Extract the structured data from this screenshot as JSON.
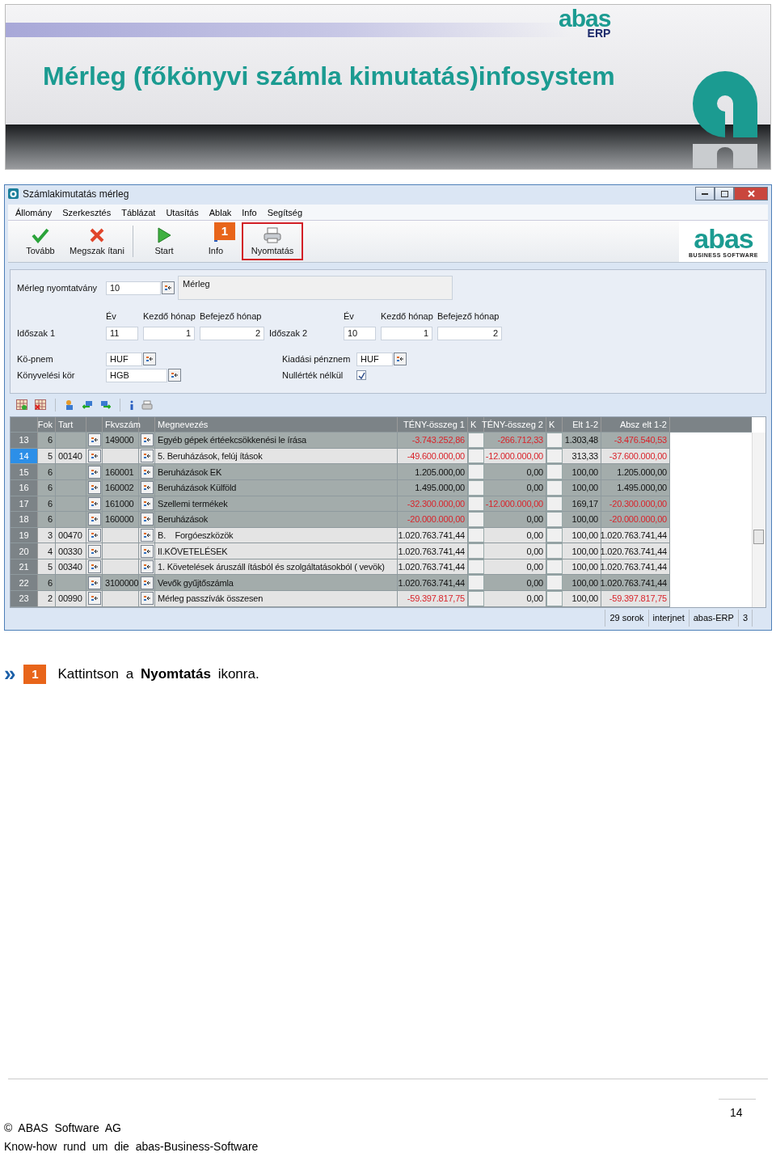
{
  "banner": {
    "title": "Mérleg (főkönyvi számla kimutatás)infosystem",
    "logo_word": "abas",
    "logo_sub": "ERP"
  },
  "window": {
    "title": "Számlakimutatás mérleg",
    "menu": [
      "Állomány",
      "Szerkesztés",
      "Táblázat",
      "Utasítás",
      "Ablak",
      "Info",
      "Segítség"
    ],
    "toolbar": [
      {
        "kind": "check",
        "label": "Tovább",
        "highlighted": false
      },
      {
        "kind": "cancel",
        "label": "Megszak ítani",
        "highlighted": false
      },
      {
        "kind": "start",
        "label": "Start",
        "highlighted": false
      },
      {
        "kind": "info",
        "label": "Info",
        "highlighted": false
      },
      {
        "kind": "print",
        "label": "Nyomtatás",
        "highlighted": true,
        "callout": "1"
      }
    ],
    "brand": {
      "word": "abas",
      "sub": "BUSINESS SOFTWARE"
    },
    "form": {
      "print_form": {
        "label": "Mérleg nyomtatvány",
        "value": "10",
        "description": "Mérleg"
      },
      "periods": [
        {
          "headers": [
            "Év",
            "Kezdő hónap",
            "Befejező hónap"
          ],
          "label": "Időszak 1",
          "year": "11",
          "start": "1",
          "end": "2"
        },
        {
          "headers": [
            "Év",
            "Kezdő hónap",
            "Befejező hónap"
          ],
          "label": "Időszak 2",
          "year": "10",
          "start": "1",
          "end": "2"
        }
      ],
      "currency": {
        "label": "Kö-pnem",
        "value": "HUF"
      },
      "ledger": {
        "label": "Könyvelési kör",
        "value": "HGB"
      },
      "output_currency": {
        "label": "Kiadási pénznem",
        "value": "HUF"
      },
      "no_zero": {
        "label": "Nullérték nélkül",
        "checked": true
      }
    },
    "table": {
      "columns": [
        "Fok",
        "Tart",
        "Fkvszám",
        "Megnevezés",
        "TÉNY-összeg 1",
        "K",
        "TÉNY-összeg 2",
        "K",
        "Elt 1-2",
        "Absz elt 1-2"
      ],
      "rows": [
        {
          "num": "13",
          "kind": "account",
          "selected": false,
          "fok": "6",
          "tart": "",
          "account": "149000",
          "name": "Egyéb gépek értéekcsökkenési le írása",
          "t1": {
            "text": "-3.743.252,86",
            "negative": true
          },
          "t2": {
            "text": "-266.712,33",
            "negative": true
          },
          "elt": "1.303,48",
          "abs": {
            "text": "-3.476.540,53",
            "negative": true
          }
        },
        {
          "num": "14",
          "kind": "group",
          "selected": true,
          "fok": "5",
          "tart": "00140",
          "account": "",
          "name": "5. Beruházások, felúj ítások",
          "t1": {
            "text": "-49.600.000,00",
            "negative": true
          },
          "t2": {
            "text": "-12.000.000,00",
            "negative": true
          },
          "elt": "313,33",
          "abs": {
            "text": "-37.600.000,00",
            "negative": true
          }
        },
        {
          "num": "15",
          "kind": "account",
          "selected": false,
          "fok": "6",
          "tart": "",
          "account": "160001",
          "name": "Beruházások EK",
          "t1": {
            "text": "1.205.000,00",
            "negative": false
          },
          "t2": {
            "text": "0,00",
            "negative": false
          },
          "elt": "100,00",
          "abs": {
            "text": "1.205.000,00",
            "negative": false
          }
        },
        {
          "num": "16",
          "kind": "account",
          "selected": false,
          "fok": "6",
          "tart": "",
          "account": "160002",
          "name": "Beruházások Külföld",
          "t1": {
            "text": "1.495.000,00",
            "negative": false
          },
          "t2": {
            "text": "0,00",
            "negative": false
          },
          "elt": "100,00",
          "abs": {
            "text": "1.495.000,00",
            "negative": false
          }
        },
        {
          "num": "17",
          "kind": "account",
          "selected": false,
          "fok": "6",
          "tart": "",
          "account": "161000",
          "name": "Szellemi termékek",
          "t1": {
            "text": "-32.300.000,00",
            "negative": true
          },
          "t2": {
            "text": "-12.000.000,00",
            "negative": true
          },
          "elt": "169,17",
          "abs": {
            "text": "-20.300.000,00",
            "negative": true
          }
        },
        {
          "num": "18",
          "kind": "account",
          "selected": false,
          "fok": "6",
          "tart": "",
          "account": "160000",
          "name": "Beruházások",
          "t1": {
            "text": "-20.000.000,00",
            "negative": true
          },
          "t2": {
            "text": "0,00",
            "negative": false
          },
          "elt": "100,00",
          "abs": {
            "text": "-20.000.000,00",
            "negative": true
          }
        },
        {
          "num": "19",
          "kind": "group",
          "selected": false,
          "fok": "3",
          "tart": "00470",
          "account": "",
          "name": "B.    Forgóeszközök",
          "t1": {
            "text": "1.020.763.741,44",
            "negative": false
          },
          "t2": {
            "text": "0,00",
            "negative": false
          },
          "elt": "100,00",
          "abs": {
            "text": "1.020.763.741,44",
            "negative": false
          }
        },
        {
          "num": "20",
          "kind": "group",
          "selected": false,
          "fok": "4",
          "tart": "00330",
          "account": "",
          "name": "II.KÖVETELÉSEK",
          "t1": {
            "text": "1.020.763.741,44",
            "negative": false
          },
          "t2": {
            "text": "0,00",
            "negative": false
          },
          "elt": "100,00",
          "abs": {
            "text": "1.020.763.741,44",
            "negative": false
          }
        },
        {
          "num": "21",
          "kind": "group",
          "selected": false,
          "fok": "5",
          "tart": "00340",
          "account": "",
          "name": "1. Követelések áruszáll ításból és szolgáltatásokból ( vevök)",
          "t1": {
            "text": "1.020.763.741,44",
            "negative": false
          },
          "t2": {
            "text": "0,00",
            "negative": false
          },
          "elt": "100,00",
          "abs": {
            "text": "1.020.763.741,44",
            "negative": false
          }
        },
        {
          "num": "22",
          "kind": "account",
          "selected": false,
          "fok": "6",
          "tart": "",
          "account": "3100000",
          "name": "Vevők gyűjtőszámla",
          "t1": {
            "text": "1.020.763.741,44",
            "negative": false
          },
          "t2": {
            "text": "0,00",
            "negative": false
          },
          "elt": "100,00",
          "abs": {
            "text": "1.020.763.741,44",
            "negative": false
          }
        },
        {
          "num": "23",
          "kind": "group",
          "selected": false,
          "fok": "2",
          "tart": "00990",
          "account": "",
          "name": "Mérleg passzívák összesen",
          "t1": {
            "text": "-59.397.817,75",
            "negative": true
          },
          "t2": {
            "text": "0,00",
            "negative": false
          },
          "elt": "100,00",
          "abs": {
            "text": "-59.397.817,75",
            "negative": true
          }
        }
      ]
    },
    "status_bar": [
      "29 sorok",
      "interjnet",
      "abas-ERP",
      "3"
    ]
  },
  "instruction": {
    "marker": "»",
    "step": "1",
    "text": "Kattintson a **Nyomtatás** ikonra."
  },
  "footer": {
    "page": "14",
    "copyright": "©  ABAS  Software  AG",
    "tagline": "Know-how  rund  um  die  abas-Business-Software"
  }
}
